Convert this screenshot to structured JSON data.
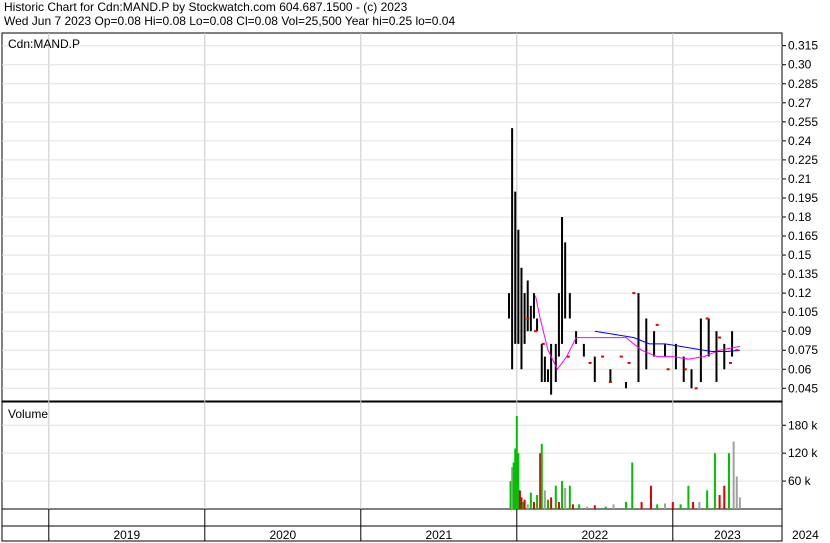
{
  "header": {
    "line1": "Historic Chart for Cdn:MAND.P by Stockwatch.com 604.687.1500 - (c) 2023",
    "line2": "Wed Jun  7 2023   Op=0.08  Hi=0.08  Lo=0.08  Cl=0.08  Vol=25,500  Year hi=0.25  lo=0.04"
  },
  "chart_data": [
    {
      "type": "line",
      "title": "Cdn:MAND.P",
      "ylim": [
        0.035,
        0.325
      ],
      "y_ticks": [
        "0.315",
        "0.30",
        "0.285",
        "0.27",
        "0.255",
        "0.24",
        "0.225",
        "0.21",
        "0.195",
        "0.18",
        "0.165",
        "0.15",
        "0.135",
        "0.12",
        "0.105",
        "0.09",
        "0.075",
        "0.06",
        "0.045"
      ],
      "x_years": [
        "2019",
        "2020",
        "2021",
        "2022",
        "2023",
        "2024"
      ],
      "grid": true,
      "price_bars": [
        {
          "x": 2021.95,
          "hi": 0.12,
          "lo": 0.1
        },
        {
          "x": 2021.97,
          "hi": 0.25,
          "lo": 0.06
        },
        {
          "x": 2021.99,
          "hi": 0.2,
          "lo": 0.08
        },
        {
          "x": 2022.01,
          "hi": 0.17,
          "lo": 0.08
        },
        {
          "x": 2022.03,
          "hi": 0.14,
          "lo": 0.06
        },
        {
          "x": 2022.05,
          "hi": 0.12,
          "lo": 0.08
        },
        {
          "x": 2022.07,
          "hi": 0.13,
          "lo": 0.09
        },
        {
          "x": 2022.09,
          "hi": 0.11,
          "lo": 0.09
        },
        {
          "x": 2022.11,
          "hi": 0.12,
          "lo": 0.1
        },
        {
          "x": 2022.13,
          "hi": 0.1,
          "lo": 0.09
        },
        {
          "x": 2022.16,
          "hi": 0.08,
          "lo": 0.05
        },
        {
          "x": 2022.18,
          "hi": 0.07,
          "lo": 0.05
        },
        {
          "x": 2022.2,
          "hi": 0.06,
          "lo": 0.05
        },
        {
          "x": 2022.22,
          "hi": 0.08,
          "lo": 0.04
        },
        {
          "x": 2022.25,
          "hi": 0.08,
          "lo": 0.05
        },
        {
          "x": 2022.27,
          "hi": 0.12,
          "lo": 0.07
        },
        {
          "x": 2022.29,
          "hi": 0.18,
          "lo": 0.08
        },
        {
          "x": 2022.31,
          "hi": 0.16,
          "lo": 0.1
        },
        {
          "x": 2022.34,
          "hi": 0.12,
          "lo": 0.1
        },
        {
          "x": 2022.38,
          "hi": 0.09,
          "lo": 0.08
        },
        {
          "x": 2022.43,
          "hi": 0.08,
          "lo": 0.07
        },
        {
          "x": 2022.5,
          "hi": 0.07,
          "lo": 0.05
        },
        {
          "x": 2022.6,
          "hi": 0.06,
          "lo": 0.05
        },
        {
          "x": 2022.7,
          "hi": 0.05,
          "lo": 0.045
        },
        {
          "x": 2022.78,
          "hi": 0.12,
          "lo": 0.05
        },
        {
          "x": 2022.83,
          "hi": 0.1,
          "lo": 0.06
        },
        {
          "x": 2022.88,
          "hi": 0.09,
          "lo": 0.07
        },
        {
          "x": 2022.95,
          "hi": 0.08,
          "lo": 0.07
        },
        {
          "x": 2023.02,
          "hi": 0.08,
          "lo": 0.06
        },
        {
          "x": 2023.07,
          "hi": 0.07,
          "lo": 0.05
        },
        {
          "x": 2023.12,
          "hi": 0.06,
          "lo": 0.045
        },
        {
          "x": 2023.18,
          "hi": 0.1,
          "lo": 0.05
        },
        {
          "x": 2023.23,
          "hi": 0.1,
          "lo": 0.07
        },
        {
          "x": 2023.28,
          "hi": 0.09,
          "lo": 0.05
        },
        {
          "x": 2023.33,
          "hi": 0.08,
          "lo": 0.06
        },
        {
          "x": 2023.38,
          "hi": 0.09,
          "lo": 0.07
        },
        {
          "x": 2023.43,
          "hi": 0.08,
          "lo": 0.08
        }
      ],
      "series": [
        {
          "color": "#ff00ff",
          "points": [
            [
              2022.12,
              0.118
            ],
            [
              2022.15,
              0.1
            ],
            [
              2022.2,
              0.075
            ],
            [
              2022.26,
              0.06
            ],
            [
              2022.32,
              0.07
            ],
            [
              2022.38,
              0.085
            ],
            [
              2022.5,
              0.085
            ],
            [
              2022.62,
              0.085
            ],
            [
              2022.7,
              0.085
            ],
            [
              2022.8,
              0.075
            ],
            [
              2022.9,
              0.07
            ],
            [
              2023.0,
              0.07
            ],
            [
              2023.1,
              0.068
            ],
            [
              2023.2,
              0.07
            ],
            [
              2023.3,
              0.075
            ],
            [
              2023.43,
              0.078
            ]
          ]
        },
        {
          "color": "#0000ff",
          "points": [
            [
              2022.5,
              0.09
            ],
            [
              2022.65,
              0.087
            ],
            [
              2022.75,
              0.085
            ],
            [
              2022.85,
              0.08
            ],
            [
              2022.95,
              0.08
            ],
            [
              2023.05,
              0.078
            ],
            [
              2023.15,
              0.076
            ],
            [
              2023.25,
              0.074
            ],
            [
              2023.35,
              0.074
            ],
            [
              2023.43,
              0.075
            ]
          ]
        }
      ],
      "red_marks": [
        [
          2022.07,
          0.1
        ],
        [
          2022.12,
          0.09
        ],
        [
          2022.17,
          0.08
        ],
        [
          2022.33,
          0.07
        ],
        [
          2022.47,
          0.065
        ],
        [
          2022.55,
          0.07
        ],
        [
          2022.6,
          0.05
        ],
        [
          2022.67,
          0.07
        ],
        [
          2022.72,
          0.065
        ],
        [
          2022.75,
          0.12
        ],
        [
          2022.9,
          0.095
        ],
        [
          2022.97,
          0.06
        ],
        [
          2023.08,
          0.06
        ],
        [
          2023.15,
          0.045
        ],
        [
          2023.22,
          0.1
        ],
        [
          2023.3,
          0.085
        ],
        [
          2023.37,
          0.065
        ],
        [
          2023.41,
          0.075
        ]
      ]
    },
    {
      "type": "bar",
      "title": "Volume",
      "ylim": [
        0,
        230000
      ],
      "y_ticks": [
        "180 k",
        "120 k",
        "60 k"
      ],
      "bars": [
        {
          "x": 2021.96,
          "v": 60000,
          "c": "#00c000"
        },
        {
          "x": 2021.97,
          "v": 90000,
          "c": "#a0a0a0"
        },
        {
          "x": 2021.98,
          "v": 100000,
          "c": "#00c000"
        },
        {
          "x": 2021.99,
          "v": 130000,
          "c": "#00c000"
        },
        {
          "x": 2022.0,
          "v": 200000,
          "c": "#00c000"
        },
        {
          "x": 2022.01,
          "v": 120000,
          "c": "#00c000"
        },
        {
          "x": 2022.02,
          "v": 40000,
          "c": "#e00000"
        },
        {
          "x": 2022.03,
          "v": 25000,
          "c": "#e00000"
        },
        {
          "x": 2022.04,
          "v": 15000,
          "c": "#00c000"
        },
        {
          "x": 2022.05,
          "v": 20000,
          "c": "#e00000"
        },
        {
          "x": 2022.07,
          "v": 10000,
          "c": "#a0a0a0"
        },
        {
          "x": 2022.09,
          "v": 35000,
          "c": "#00c000"
        },
        {
          "x": 2022.11,
          "v": 15000,
          "c": "#e00000"
        },
        {
          "x": 2022.13,
          "v": 30000,
          "c": "#00c000"
        },
        {
          "x": 2022.15,
          "v": 120000,
          "c": "#e00000"
        },
        {
          "x": 2022.16,
          "v": 140000,
          "c": "#00c000"
        },
        {
          "x": 2022.18,
          "v": 40000,
          "c": "#a0a0a0"
        },
        {
          "x": 2022.2,
          "v": 20000,
          "c": "#00c000"
        },
        {
          "x": 2022.22,
          "v": 25000,
          "c": "#e00000"
        },
        {
          "x": 2022.25,
          "v": 50000,
          "c": "#00c000"
        },
        {
          "x": 2022.27,
          "v": 15000,
          "c": "#e00000"
        },
        {
          "x": 2022.29,
          "v": 60000,
          "c": "#00c000"
        },
        {
          "x": 2022.31,
          "v": 45000,
          "c": "#a0a0a0"
        },
        {
          "x": 2022.34,
          "v": 50000,
          "c": "#00c000"
        },
        {
          "x": 2022.36,
          "v": 10000,
          "c": "#e00000"
        },
        {
          "x": 2022.4,
          "v": 10000,
          "c": "#00c000"
        },
        {
          "x": 2022.45,
          "v": 5000,
          "c": "#a0a0a0"
        },
        {
          "x": 2022.5,
          "v": 8000,
          "c": "#e00000"
        },
        {
          "x": 2022.57,
          "v": 5000,
          "c": "#00c000"
        },
        {
          "x": 2022.62,
          "v": 10000,
          "c": "#a0a0a0"
        },
        {
          "x": 2022.7,
          "v": 15000,
          "c": "#00c000"
        },
        {
          "x": 2022.74,
          "v": 100000,
          "c": "#00c000"
        },
        {
          "x": 2022.8,
          "v": 15000,
          "c": "#e00000"
        },
        {
          "x": 2022.86,
          "v": 50000,
          "c": "#e00000"
        },
        {
          "x": 2022.9,
          "v": 10000,
          "c": "#00c000"
        },
        {
          "x": 2022.95,
          "v": 12000,
          "c": "#a0a0a0"
        },
        {
          "x": 2023.0,
          "v": 15000,
          "c": "#e00000"
        },
        {
          "x": 2023.05,
          "v": 10000,
          "c": "#00c000"
        },
        {
          "x": 2023.1,
          "v": 50000,
          "c": "#00c000"
        },
        {
          "x": 2023.13,
          "v": 15000,
          "c": "#e00000"
        },
        {
          "x": 2023.17,
          "v": 15000,
          "c": "#a0a0a0"
        },
        {
          "x": 2023.22,
          "v": 40000,
          "c": "#00c000"
        },
        {
          "x": 2023.27,
          "v": 120000,
          "c": "#00c000"
        },
        {
          "x": 2023.3,
          "v": 30000,
          "c": "#e00000"
        },
        {
          "x": 2023.33,
          "v": 50000,
          "c": "#e00000"
        },
        {
          "x": 2023.36,
          "v": 120000,
          "c": "#00c000"
        },
        {
          "x": 2023.39,
          "v": 145000,
          "c": "#a0a0a0"
        },
        {
          "x": 2023.41,
          "v": 70000,
          "c": "#a0a0a0"
        },
        {
          "x": 2023.43,
          "v": 25000,
          "c": "#a0a0a0"
        }
      ]
    }
  ]
}
